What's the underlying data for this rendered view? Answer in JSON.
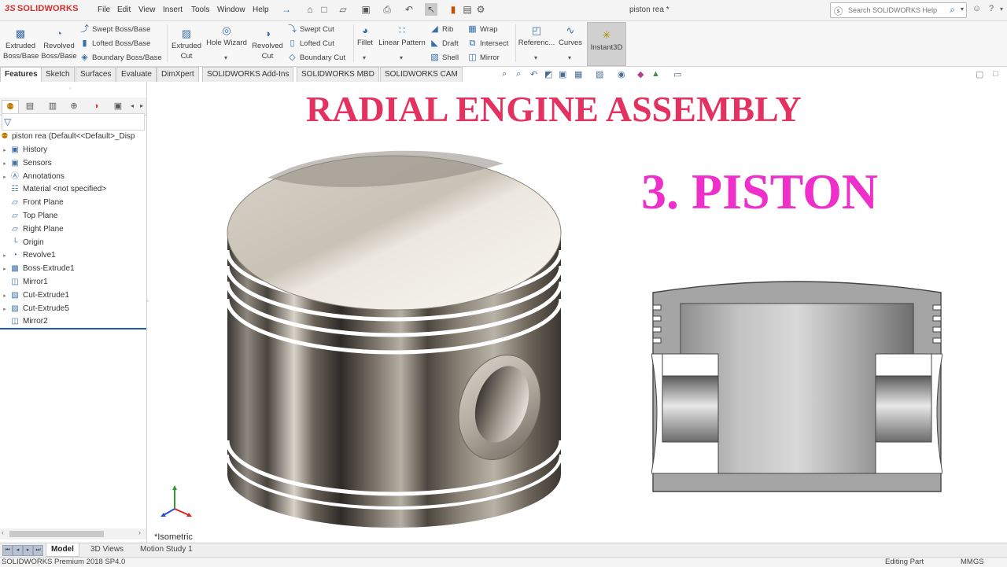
{
  "app": {
    "brand": "SOLIDWORKS",
    "brand_prefix": "3S",
    "document_title": "piston rea *"
  },
  "menu": [
    "File",
    "Edit",
    "View",
    "Insert",
    "Tools",
    "Window",
    "Help"
  ],
  "search": {
    "placeholder": "Search SOLIDWORKS Help"
  },
  "ribbon": {
    "extruded_boss": [
      "Extruded",
      "Boss/Base"
    ],
    "revolved_boss": [
      "Revolved",
      "Boss/Base"
    ],
    "swept_boss": "Swept Boss/Base",
    "lofted_boss": "Lofted Boss/Base",
    "boundary_boss": "Boundary Boss/Base",
    "extruded_cut": [
      "Extruded",
      "Cut"
    ],
    "hole_wizard": "Hole Wizard",
    "revolved_cut": [
      "Revolved",
      "Cut"
    ],
    "swept_cut": "Swept Cut",
    "lofted_cut": "Lofted Cut",
    "boundary_cut": "Boundary Cut",
    "fillet": "Fillet",
    "linear_pattern": "Linear Pattern",
    "rib": "Rib",
    "draft": "Draft",
    "shell": "Shell",
    "wrap": "Wrap",
    "intersect": "Intersect",
    "mirror": "Mirror",
    "reference": "Referenc...",
    "curves": "Curves",
    "instant3d": "Instant3D"
  },
  "command_tabs": [
    "Features",
    "Sketch",
    "Surfaces",
    "Evaluate",
    "DimXpert",
    "SOLIDWORKS Add-Ins",
    "SOLIDWORKS MBD",
    "SOLIDWORKS CAM"
  ],
  "feature_tree": {
    "root": "piston rea  (Default<<Default>_Disp",
    "items": [
      {
        "label": "History",
        "icon": "history-folder-icon",
        "expandable": true
      },
      {
        "label": "Sensors",
        "icon": "sensors-folder-icon",
        "expandable": true
      },
      {
        "label": "Annotations",
        "icon": "annotations-icon",
        "expandable": true
      },
      {
        "label": "Material <not specified>",
        "icon": "material-icon",
        "expandable": false
      },
      {
        "label": "Front Plane",
        "icon": "plane-icon",
        "expandable": false
      },
      {
        "label": "Top Plane",
        "icon": "plane-icon",
        "expandable": false
      },
      {
        "label": "Right Plane",
        "icon": "plane-icon",
        "expandable": false
      },
      {
        "label": "Origin",
        "icon": "origin-icon",
        "expandable": false
      },
      {
        "label": "Revolve1",
        "icon": "revolve-feature-icon",
        "expandable": true
      },
      {
        "label": "Boss-Extrude1",
        "icon": "extrude-feature-icon",
        "expandable": true
      },
      {
        "label": "Mirror1",
        "icon": "mirror-feature-icon",
        "expandable": false
      },
      {
        "label": "Cut-Extrude1",
        "icon": "cut-extrude-icon",
        "expandable": true
      },
      {
        "label": "Cut-Extrude5",
        "icon": "cut-extrude-icon",
        "expandable": true
      },
      {
        "label": "Mirror2",
        "icon": "mirror-feature-icon",
        "expandable": false
      }
    ]
  },
  "bottom_tabs": [
    "Model",
    "3D Views",
    "Motion Study 1"
  ],
  "status": {
    "version": "SOLIDWORKS Premium 2018 SP4.0",
    "mode": "Editing Part",
    "units": "MMGS"
  },
  "canvas": {
    "heading": "RADIAL ENGINE ASSEMBLY",
    "subheading": "3. PISTON",
    "view_orientation": "*Isometric",
    "heading_color": "#e33160",
    "subheading_color": "#ee2fc9"
  }
}
